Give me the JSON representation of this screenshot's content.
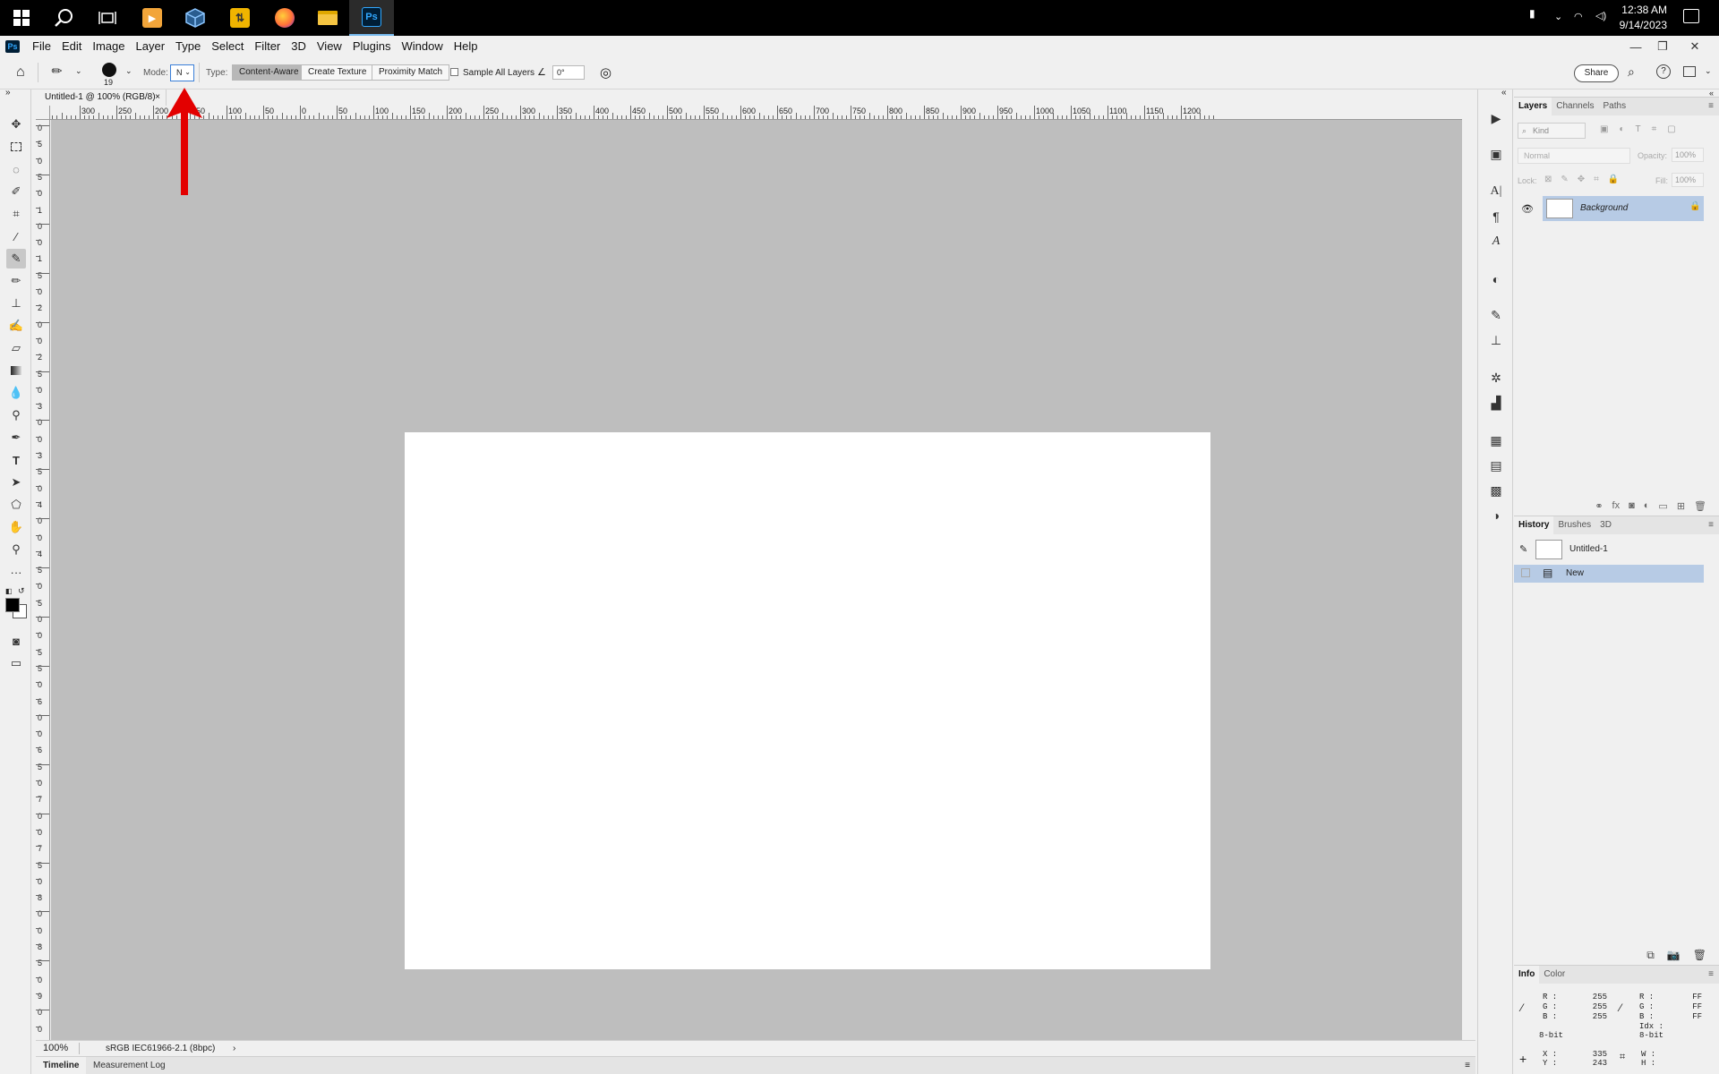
{
  "taskbar": {
    "apps": [
      {
        "name": "windows-start-icon",
        "color": "#ffffff"
      },
      {
        "name": "search-icon",
        "color": "#ffffff"
      },
      {
        "name": "task-view-icon",
        "color": "#ffffff"
      },
      {
        "name": "media-player-icon",
        "color": "#f2a53a"
      },
      {
        "name": "virtualbox-icon",
        "color": "#5aa0d8"
      },
      {
        "name": "winscp-icon",
        "color": "#f0b400"
      },
      {
        "name": "firefox-icon",
        "color": "#ff7139"
      },
      {
        "name": "file-explorer-icon",
        "color": "#f5c542"
      },
      {
        "name": "photoshop-icon",
        "color": "#31a8ff"
      }
    ],
    "time": "12:38 AM",
    "date": "9/14/2023"
  },
  "menubar": {
    "logo": "Ps",
    "items": [
      "File",
      "Edit",
      "Image",
      "Layer",
      "Type",
      "Select",
      "Filter",
      "3D",
      "View",
      "Plugins",
      "Window",
      "Help"
    ]
  },
  "options": {
    "brush_size": "19",
    "mode_label": "Mode:",
    "mode_value": "N",
    "type_label": "Type:",
    "type_buttons": [
      "Content-Aware",
      "Create Texture",
      "Proximity Match"
    ],
    "selected_type": "Content-Aware",
    "sample_all_layers": "Sample All Layers",
    "angle": "0°",
    "share": "Share"
  },
  "document": {
    "tab_title": "Untitled-1 @ 100% (RGB/8)",
    "zoom": "100%",
    "profile": "sRGB IEC61966-2.1 (8bpc)"
  },
  "rulers": {
    "h_labels": [
      "0",
      "300",
      "250",
      "200",
      "150",
      "100",
      "50",
      "0",
      "50",
      "100",
      "150",
      "200",
      "250",
      "300",
      "350",
      "400",
      "450",
      "500",
      "550",
      "600",
      "650",
      "700",
      "750",
      "800",
      "850",
      "900",
      "950",
      "1000",
      "1050",
      "1100",
      "1150",
      "1200"
    ],
    "v_labels": [
      "0",
      "5",
      "0",
      "5",
      "0",
      "1",
      "0",
      "0",
      "1",
      "5",
      "0",
      "2",
      "0",
      "0",
      "2",
      "5",
      "0",
      "3",
      "0",
      "0",
      "3",
      "5",
      "0",
      "4",
      "0",
      "0",
      "4",
      "5",
      "0",
      "5",
      "0",
      "0",
      "5",
      "5",
      "0",
      "6",
      "0",
      "0",
      "6",
      "5",
      "0",
      "7",
      "0",
      "0",
      "7",
      "5",
      "0",
      "8",
      "0",
      "0",
      "8",
      "5",
      "0",
      "9",
      "0",
      "0"
    ]
  },
  "bottom_tabs": [
    "Timeline",
    "Measurement Log"
  ],
  "layers_panel": {
    "tabs": [
      "Layers",
      "Channels",
      "Paths"
    ],
    "kind": "Kind",
    "blend": "Normal",
    "opacity_label": "Opacity:",
    "opacity": "100%",
    "lock_label": "Lock:",
    "fill_label": "Fill:",
    "fill": "100%",
    "layer_name": "Background"
  },
  "history_panel": {
    "tabs": [
      "History",
      "Brushes",
      "3D"
    ],
    "snapshot": "Untitled-1",
    "state": "New"
  },
  "info_panel": {
    "tabs": [
      "Info",
      "Color"
    ],
    "rgb_labels": [
      "R :",
      "G :",
      "B :"
    ],
    "rgb_values": [
      "255",
      "255",
      "255"
    ],
    "hex_values": [
      "FF",
      "FF",
      "FF"
    ],
    "idx_label": "Idx :",
    "bit_left": "8-bit",
    "bit_right": "8-bit",
    "x_label": "X :",
    "y_label": "Y :",
    "x_value": "335",
    "y_value": "243",
    "w_label": "W :",
    "h_label": "H :"
  },
  "annotation": {
    "color": "#e30000"
  }
}
